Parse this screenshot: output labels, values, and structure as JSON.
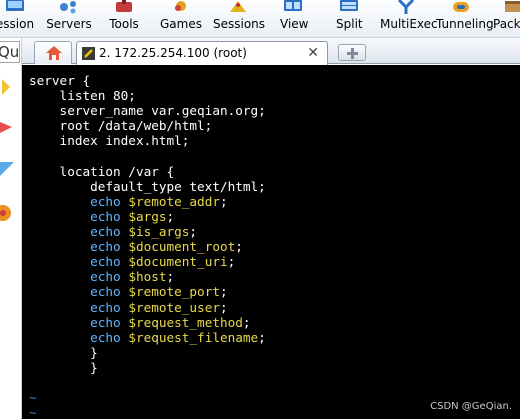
{
  "toolbar": {
    "items": [
      {
        "label": "ession",
        "icon": "session-icon"
      },
      {
        "label": "Servers",
        "icon": "servers-icon"
      },
      {
        "label": "Tools",
        "icon": "tools-icon"
      },
      {
        "label": "Games",
        "icon": "games-icon"
      },
      {
        "label": "Sessions",
        "icon": "sessions-icon"
      },
      {
        "label": "View",
        "icon": "view-icon"
      },
      {
        "label": "Split",
        "icon": "split-icon"
      },
      {
        "label": "MultiExec",
        "icon": "multiexec-icon"
      },
      {
        "label": "Tunneling",
        "icon": "tunneling-icon"
      },
      {
        "label": "Packa",
        "icon": "packages-icon"
      }
    ]
  },
  "quick_search": {
    "text": "Qu"
  },
  "tabs": {
    "home_icon": "home-icon",
    "session_title": "2. 172.25.254.100 (root)",
    "close_glyph": "✕"
  },
  "terminal": {
    "lines": [
      [
        {
          "t": "server {",
          "c": "text"
        }
      ],
      [
        {
          "t": "    listen 80;",
          "c": "text"
        }
      ],
      [
        {
          "t": "    server_name var.geqian.org;",
          "c": "text"
        }
      ],
      [
        {
          "t": "    root /data/web/html;",
          "c": "text"
        }
      ],
      [
        {
          "t": "    index index.html;",
          "c": "text"
        }
      ],
      [
        {
          "t": "",
          "c": "text"
        }
      ],
      [
        {
          "t": "    location /var {",
          "c": "text"
        }
      ],
      [
        {
          "t": "        default_type text/html;",
          "c": "text"
        }
      ],
      [
        {
          "t": "        echo ",
          "c": "kw"
        },
        {
          "t": "$remote_addr",
          "c": "var"
        },
        {
          "t": ";",
          "c": "text"
        }
      ],
      [
        {
          "t": "        echo ",
          "c": "kw"
        },
        {
          "t": "$args",
          "c": "var"
        },
        {
          "t": ";",
          "c": "text"
        }
      ],
      [
        {
          "t": "        echo ",
          "c": "kw"
        },
        {
          "t": "$is_args",
          "c": "var"
        },
        {
          "t": ";",
          "c": "text"
        }
      ],
      [
        {
          "t": "        echo ",
          "c": "kw"
        },
        {
          "t": "$document_root",
          "c": "var"
        },
        {
          "t": ";",
          "c": "text"
        }
      ],
      [
        {
          "t": "        echo ",
          "c": "kw"
        },
        {
          "t": "$document_uri",
          "c": "var"
        },
        {
          "t": ";",
          "c": "text"
        }
      ],
      [
        {
          "t": "        echo ",
          "c": "kw"
        },
        {
          "t": "$host",
          "c": "var"
        },
        {
          "t": ";",
          "c": "text"
        }
      ],
      [
        {
          "t": "        echo ",
          "c": "kw"
        },
        {
          "t": "$remote_port",
          "c": "var"
        },
        {
          "t": ";",
          "c": "text"
        }
      ],
      [
        {
          "t": "        echo ",
          "c": "kw"
        },
        {
          "t": "$remote_user",
          "c": "var"
        },
        {
          "t": ";",
          "c": "text"
        }
      ],
      [
        {
          "t": "        echo ",
          "c": "kw"
        },
        {
          "t": "$request_method",
          "c": "var"
        },
        {
          "t": ";",
          "c": "text"
        }
      ],
      [
        {
          "t": "        echo ",
          "c": "kw"
        },
        {
          "t": "$request_filename",
          "c": "var"
        },
        {
          "t": ";",
          "c": "text"
        }
      ],
      [
        {
          "t": "        }",
          "c": "text"
        }
      ],
      [
        {
          "t": "        }",
          "c": "text"
        }
      ],
      [
        {
          "t": "",
          "c": "text"
        }
      ],
      [
        {
          "t": "~",
          "c": "tilde"
        }
      ],
      [
        {
          "t": "~",
          "c": "tilde"
        }
      ],
      [
        {
          "t": "~",
          "c": "tilde"
        }
      ]
    ]
  },
  "watermark": "CSDN @GeQian.",
  "colors": {
    "terminal_bg": "#000000",
    "text": "#ffffff",
    "keyword": "#5fb3ff",
    "variable": "#e8d84a",
    "tilde": "#3a7bd5"
  }
}
